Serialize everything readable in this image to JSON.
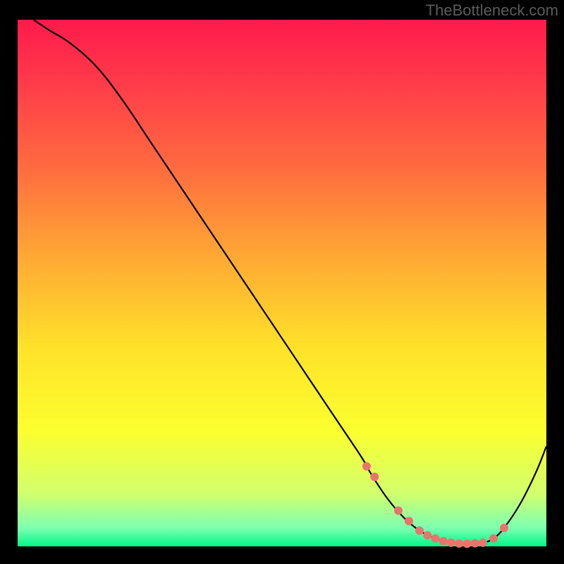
{
  "watermark": "TheBottleneck.com",
  "chart_data": {
    "type": "line",
    "title": "",
    "xlabel": "",
    "ylabel": "",
    "xlim": [
      0,
      100
    ],
    "ylim": [
      0,
      100
    ],
    "grid": false,
    "background_gradient": {
      "type": "vertical",
      "stops": [
        {
          "offset": 0.0,
          "color": "#ff1a4b"
        },
        {
          "offset": 0.12,
          "color": "#ff3b4a"
        },
        {
          "offset": 0.28,
          "color": "#ff6b3f"
        },
        {
          "offset": 0.45,
          "color": "#ffa834"
        },
        {
          "offset": 0.62,
          "color": "#ffe12a"
        },
        {
          "offset": 0.78,
          "color": "#fbff2e"
        },
        {
          "offset": 0.9,
          "color": "#d2ff6e"
        },
        {
          "offset": 0.965,
          "color": "#7dffb0"
        },
        {
          "offset": 1.0,
          "color": "#00f78a"
        }
      ]
    },
    "series": [
      {
        "name": "bottleneck-curve",
        "color": "#000000",
        "x": [
          3,
          6,
          10,
          15,
          20,
          25,
          30,
          35,
          40,
          45,
          50,
          55,
          60,
          65,
          67,
          70,
          73,
          76,
          79,
          82,
          85,
          88,
          90,
          92,
          95,
          98,
          100
        ],
        "y": [
          100,
          98,
          95.5,
          91,
          84.5,
          77,
          69.5,
          62,
          54.5,
          47,
          39.5,
          32,
          24.5,
          17,
          13.5,
          9,
          5.5,
          3,
          1.5,
          0.7,
          0.5,
          0.7,
          1.5,
          3.5,
          8,
          14,
          19
        ]
      }
    ],
    "highlight_points": {
      "name": "optimal-range-markers",
      "color": "#e9746e",
      "radius_px": 6,
      "x": [
        66,
        67.5,
        72,
        74,
        76,
        77.5,
        79,
        80.5,
        82,
        83.5,
        85,
        86.5,
        88,
        90,
        92
      ],
      "y": [
        15.2,
        13.2,
        6.8,
        4.8,
        3.0,
        2.1,
        1.5,
        1.0,
        0.7,
        0.55,
        0.5,
        0.6,
        0.7,
        1.5,
        3.5
      ]
    }
  }
}
